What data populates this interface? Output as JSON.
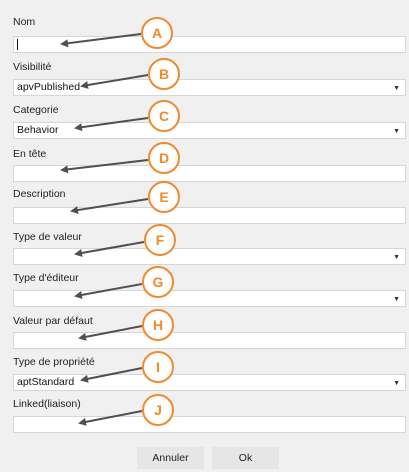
{
  "fields": [
    {
      "label": "Nom",
      "value": "",
      "type": "text",
      "badge": "A"
    },
    {
      "label": "Visibilité",
      "value": "apvPublished",
      "type": "select",
      "badge": "B"
    },
    {
      "label": "Categorie",
      "value": "Behavior",
      "type": "select",
      "badge": "C"
    },
    {
      "label": "En tête",
      "value": "",
      "type": "text",
      "badge": "D"
    },
    {
      "label": "Description",
      "value": "",
      "type": "text",
      "badge": "E"
    },
    {
      "label": "Type de valeur",
      "value": "",
      "type": "select",
      "badge": "F"
    },
    {
      "label": "Type d'éditeur",
      "value": "",
      "type": "select",
      "badge": "G"
    },
    {
      "label": "Valeur par défaut",
      "value": "",
      "type": "text",
      "badge": "H"
    },
    {
      "label": "Type de propriété",
      "value": "aptStandard",
      "type": "select",
      "badge": "I"
    },
    {
      "label": "Linked(liaison)",
      "value": "",
      "type": "text",
      "badge": "J"
    }
  ],
  "buttons": {
    "cancel_label": "Annuler",
    "ok_label": "Ok"
  },
  "colors": {
    "badge_outline": "#f08a2c",
    "badge_fill": "#ffffff",
    "arrow": "#505050",
    "field_border": "#d6d6d6"
  },
  "icons": {
    "select_arrow": "dropdown-arrow-icon"
  }
}
